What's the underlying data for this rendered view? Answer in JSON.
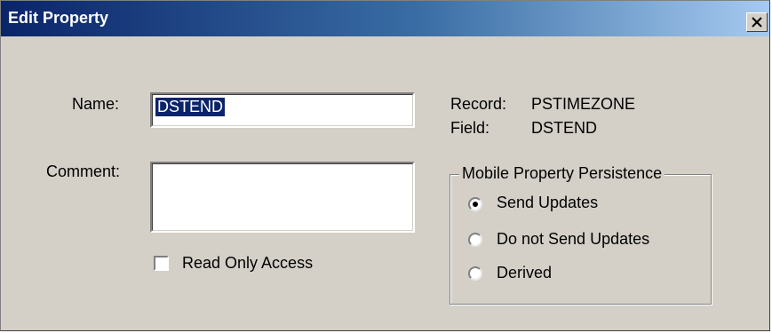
{
  "window": {
    "title": "Edit Property",
    "close_glyph": "X"
  },
  "form": {
    "name_label": "Name:",
    "name_value": "DSTEND",
    "comment_label": "Comment:",
    "comment_value": "",
    "read_only_label": "Read Only Access",
    "read_only_checked": false
  },
  "info": {
    "record_label": "Record:",
    "record_value": "PSTIMEZONE",
    "field_label": "Field:",
    "field_value": "DSTEND"
  },
  "persistence": {
    "group_label": "Mobile Property Persistence",
    "options": [
      {
        "label": "Send Updates",
        "selected": true
      },
      {
        "label": "Do not Send Updates",
        "selected": false
      },
      {
        "label": "Derived",
        "selected": false
      }
    ]
  },
  "colors": {
    "titlebar_start": "#0a246a",
    "titlebar_end": "#a6caf0",
    "face": "#d4d0c8",
    "selection": "#0a246a"
  }
}
